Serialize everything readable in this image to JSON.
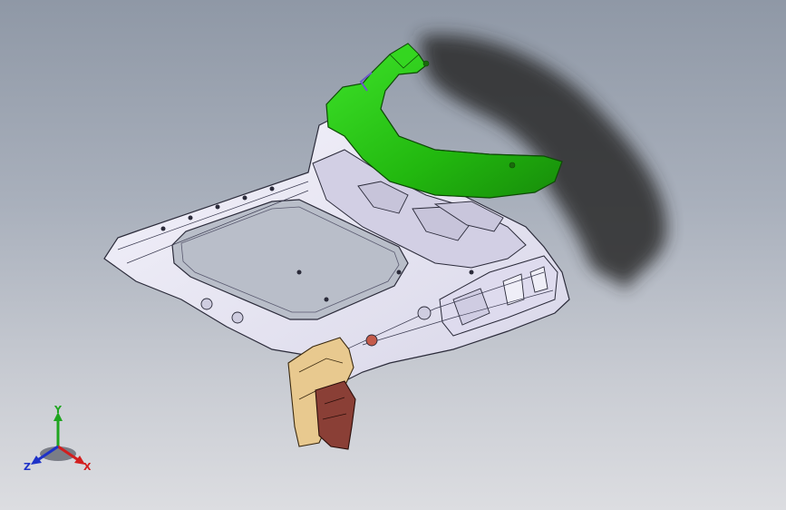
{
  "viewport": {
    "background_top": "#8f98a6",
    "background_bottom": "#dcdde1"
  },
  "model": {
    "parts": [
      {
        "name": "roof-frame",
        "color": "#e6e4f2"
      },
      {
        "name": "rear-bracket",
        "color": "#28c814"
      },
      {
        "name": "pillar-reinforcement",
        "color": "#e8c98f"
      },
      {
        "name": "pillar-inner",
        "color": "#8a3f36"
      }
    ],
    "shadow_color": "#2a2a2a"
  },
  "triad": {
    "x_label": "X",
    "y_label": "Y",
    "z_label": "Z",
    "x_color": "#d21e1e",
    "y_color": "#1fa51f",
    "z_color": "#1e32c8"
  }
}
